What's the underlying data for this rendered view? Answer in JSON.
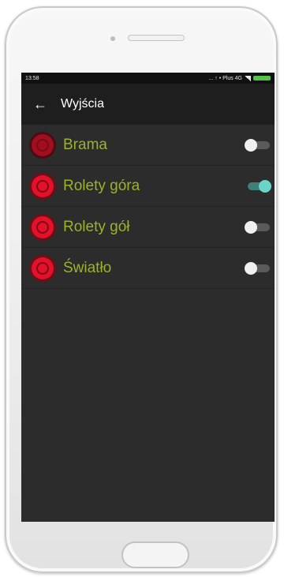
{
  "status_bar": {
    "time": "13:58",
    "network": "... ↑ • Plus 4G"
  },
  "app_bar": {
    "back_icon": "back-arrow-icon",
    "title": "Wyjścia"
  },
  "outputs": [
    {
      "label": "Brama",
      "enabled": false
    },
    {
      "label": "Rolety góra",
      "enabled": true
    },
    {
      "label": "Rolety gół",
      "enabled": false
    },
    {
      "label": "Światło",
      "enabled": false
    }
  ],
  "colors": {
    "label_text": "#9bb22a",
    "indicator": "#e5102a",
    "toggle_on": "#6ad4c9",
    "screen_bg": "#2c2c2c"
  }
}
